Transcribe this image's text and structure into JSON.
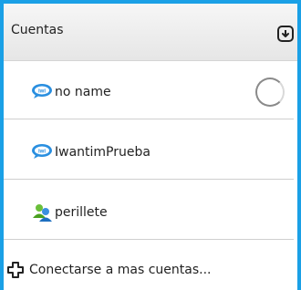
{
  "header": {
    "title": "Cuentas",
    "action_icon": "download-arrow-icon"
  },
  "accounts": [
    {
      "label": "no name",
      "icon": "iwi-chat-icon",
      "status": "loading"
    },
    {
      "label": "IwantimPrueba",
      "icon": "iwi-chat-icon"
    },
    {
      "label": "perillete",
      "icon": "messenger-buddies-icon"
    }
  ],
  "footer": {
    "label": "Conectarse a mas cuentas...",
    "icon": "plus-outline-icon"
  },
  "colors": {
    "accent_border": "#1aa0e6",
    "iwi_blue": "#2a8fe0",
    "divider": "#cfcfcf"
  }
}
